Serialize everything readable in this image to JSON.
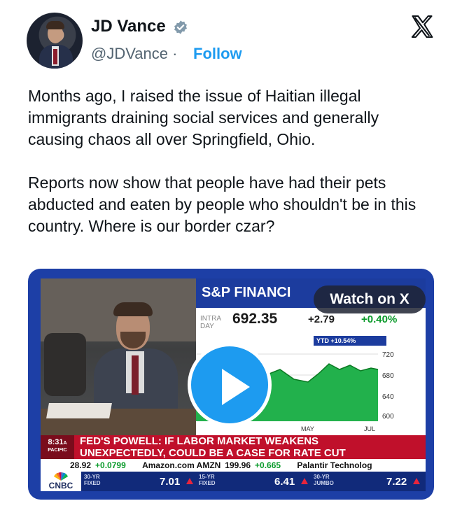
{
  "tweet": {
    "author_name": "JD Vance",
    "handle": "@JDVance",
    "separator": "·",
    "follow_label": "Follow",
    "paragraphs": [
      "Months ago, I raised the issue of Haitian illegal immigrants draining social services and generally causing chaos all over Springfield, Ohio.",
      "Reports now show that people have had their pets abducted and eaten by people who shouldn't be in this country. Where is our border czar?"
    ]
  },
  "video": {
    "watch_label": "Watch on X",
    "chart_title": "S&P FINANCI",
    "intraday_label": "INTRA DAY",
    "price": "692.35",
    "change": "+2.79",
    "change_pct": "+0.40%",
    "ytd_label": "YTD +10.54%",
    "y_ticks": [
      "720",
      "680",
      "640",
      "600"
    ],
    "x_ticks": [
      "MAY",
      "JUL"
    ],
    "time": "8:31",
    "time_suffix": "A",
    "timezone": "PACIFIC",
    "headline_line1": "FED'S POWELL: IF LABOR MARKET WEAKENS",
    "headline_line2": "UNEXPECTEDLY, COULD BE A CASE FOR RATE CUT",
    "ticker": {
      "item1_value": "28.92",
      "item1_change": "+0.0799",
      "item2_name": "Amazon.com AMZN",
      "item2_value": "199.96",
      "item2_change": "+0.665",
      "item3_name": "Palantir Technolog"
    },
    "network": "CNBC",
    "bonds": [
      {
        "label": "30-YR FIXED",
        "value": "7.01"
      },
      {
        "label": "15-YR FIXED",
        "value": "6.41"
      },
      {
        "label": "30-YR JUMBO",
        "value": "7.22"
      }
    ]
  },
  "colors": {
    "link_blue": "#1d9bf0",
    "verified_badge": "#829aab",
    "cnbc_red": "#c0102b",
    "cnbc_blue": "#1c3c9e",
    "chart_green": "#0a9a2a"
  },
  "icons": [
    "verified-badge-icon",
    "x-logo-icon",
    "play-icon",
    "cnbc-peacock-icon"
  ]
}
